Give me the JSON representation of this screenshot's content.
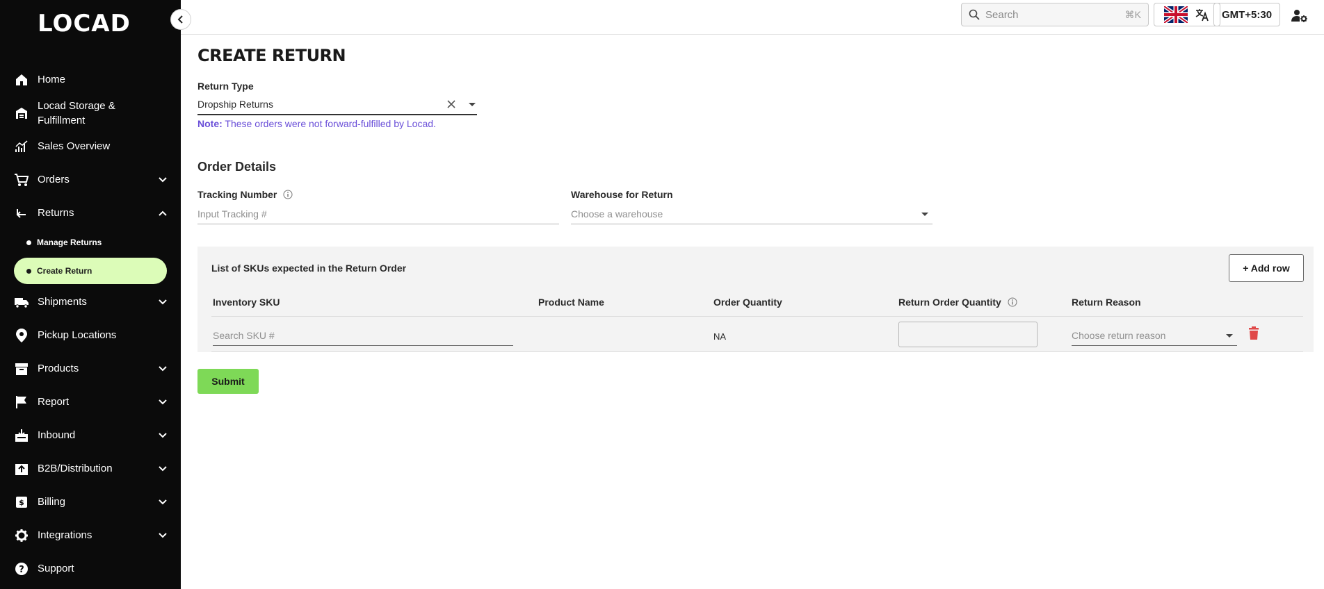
{
  "app": {
    "logo_text": "LOCAD"
  },
  "sidebar": {
    "items": [
      {
        "id": "home",
        "label": "Home",
        "icon": "home-icon"
      },
      {
        "id": "storage",
        "label": "Locad Storage &",
        "label2": "Fulfillment",
        "icon": "warehouse-icon"
      },
      {
        "id": "sales",
        "label": "Sales Overview",
        "icon": "chart-icon"
      },
      {
        "id": "orders",
        "label": "Orders",
        "icon": "cart-icon"
      },
      {
        "id": "returns",
        "label": "Returns",
        "icon": "return-icon"
      },
      {
        "id": "shipments",
        "label": "Shipments",
        "icon": "truck-icon"
      },
      {
        "id": "pickup",
        "label": "Pickup Locations",
        "icon": "pin-icon"
      },
      {
        "id": "products",
        "label": "Products",
        "icon": "box-icon"
      },
      {
        "id": "report",
        "label": "Report",
        "icon": "flag-icon"
      },
      {
        "id": "inbound",
        "label": "Inbound",
        "icon": "inbound-icon"
      },
      {
        "id": "b2b",
        "label": "B2B/Distribution",
        "icon": "distribution-icon"
      },
      {
        "id": "billing",
        "label": "Billing",
        "icon": "billing-icon"
      },
      {
        "id": "integrations",
        "label": "Integrations",
        "icon": "gear-icon"
      },
      {
        "id": "support",
        "label": "Support",
        "icon": "help-icon"
      }
    ],
    "returns_sub": [
      {
        "label": "Manage Returns",
        "active": false
      },
      {
        "label": "Create Return",
        "active": true
      }
    ]
  },
  "topbar": {
    "search_placeholder": "Search",
    "search_shortcut": "⌘K",
    "timezone": "GMT+5:30"
  },
  "page": {
    "title": "CREATE RETURN",
    "return_type_label": "Return Type",
    "return_type_value": "Dropship Returns",
    "note_prefix": "Note:",
    "note_text": " These orders were not forward-fulfilled by Locad.",
    "order_details_title": "Order Details",
    "tracking_label": "Tracking Number",
    "tracking_placeholder": "Input Tracking #",
    "warehouse_label": "Warehouse for Return",
    "warehouse_placeholder": "Choose a warehouse",
    "sku_panel_title": "List of SKUs expected in the Return Order",
    "add_row_label": "+ Add row",
    "columns": [
      "Inventory SKU",
      "Product Name",
      "Order Quantity",
      "Return Order Quantity",
      "Return Reason"
    ],
    "row": {
      "sku_placeholder": "Search SKU #",
      "order_quantity": "NA",
      "reason_placeholder": "Choose return reason"
    },
    "submit_label": "Submit"
  },
  "colors": {
    "sidebar_bg": "#0b0b0b",
    "active_sub_bg": "#dcfcb8",
    "note_color": "#6a4fd8",
    "submit_bg": "#7ed957",
    "delete_color": "#e04848"
  }
}
